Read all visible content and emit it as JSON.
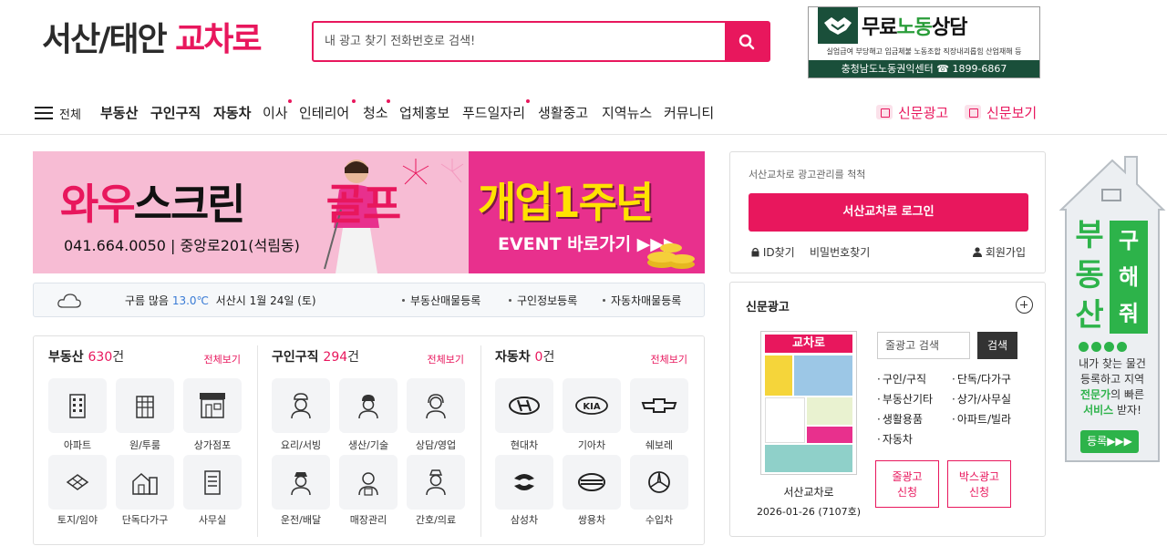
{
  "logo": {
    "part1": "서산/태안 ",
    "part2": "교차로"
  },
  "search": {
    "placeholder": "내 광고 찾기 전화번호로 검색!",
    "icon": "search-icon"
  },
  "banner_labor": {
    "title_black": "무료",
    "title_green": "노동",
    "title_black2": "상담",
    "sub": "실업급여 부당해고 임금체불 노동조합 직장내괴롭힘 산업재해 등",
    "bottom": "충청남도노동권익센터 ☎ 1899-6867"
  },
  "nav": {
    "all_label": "전체",
    "items": [
      {
        "label": "부동산",
        "bold": true
      },
      {
        "label": "구인구직",
        "bold": true
      },
      {
        "label": "자동차",
        "bold": true
      },
      {
        "label": "이사"
      },
      {
        "label": "인테리어"
      },
      {
        "label": "청소"
      },
      {
        "label": "업체홍보"
      },
      {
        "label": "푸드일자리"
      },
      {
        "label": "생활중고"
      },
      {
        "label": "지역뉴스"
      },
      {
        "label": "커뮤니티"
      }
    ],
    "right": [
      {
        "label": "신문광고"
      },
      {
        "label": "신문보기"
      }
    ]
  },
  "ad": {
    "pink": "와우",
    "black": "스크린",
    "pink2": "골프",
    "phone": "041.664.0050 | 중앙로201(석림동)",
    "right_title": "개업1주년",
    "right_sub": "EVENT 바로가기 ▶▶▶"
  },
  "weather": {
    "status": "구름 많음",
    "temp": "13.0℃",
    "date": "서산시 1월 24일 (토)",
    "links": [
      "부동산매물등록",
      "구인정보등록",
      "자동차매물등록"
    ]
  },
  "categories": [
    {
      "title": "부동산",
      "count": "630",
      "unit": "건",
      "all": "전체보기",
      "items": [
        "아파트",
        "원/투룸",
        "상가점포",
        "토지/임야",
        "단독다가구",
        "사무실"
      ]
    },
    {
      "title": "구인구직",
      "count": "294",
      "unit": "건",
      "all": "전체보기",
      "items": [
        "요리/서빙",
        "생산/기술",
        "상담/영업",
        "운전/배달",
        "매장관리",
        "간호/의료"
      ]
    },
    {
      "title": "자동차",
      "count": "0",
      "unit": "건",
      "all": "전체보기",
      "items": [
        "현대차",
        "기아차",
        "쉐보레",
        "삼성차",
        "쌍용차",
        "수입차"
      ]
    }
  ],
  "login": {
    "subtitle": "서산교차로 광고관리를 척척",
    "button": "서산교차로 로그인",
    "find_id": "ID찾기",
    "find_pw": "비밀번호찾기",
    "join": "회원가입"
  },
  "paper": {
    "title": "신문광고",
    "cover_title": "교차로",
    "name": "서산교차로",
    "issue": "2026-01-26 (7107호)",
    "search_placeholder": "줄광고 검색",
    "search_button": "검색",
    "links": [
      "구인/구직",
      "단독/다가구",
      "부동산기타",
      "상가/사무실",
      "생활용품",
      "아파트/빌라",
      "자동차"
    ],
    "btn1": [
      "줄광고",
      "신청"
    ],
    "btn2": [
      "박스광고",
      "신청"
    ]
  },
  "house": {
    "big": "부동산",
    "small": "구해줘",
    "desc1": "내가 찾는 물건",
    "desc2": "등록하고 지역",
    "desc3": "전문가",
    "desc4": "의 빠른",
    "desc5": "서비스",
    "desc6": " 받자!",
    "btn": "등록▶▶▶"
  }
}
